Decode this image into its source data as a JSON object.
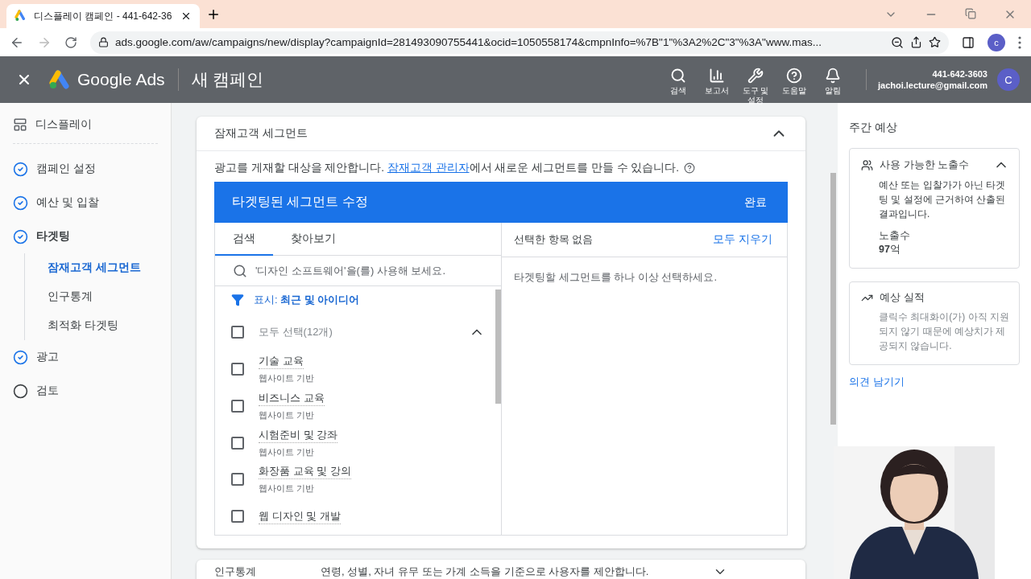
{
  "browser": {
    "tab_title": "디스플레이 캠페인 - 441-642-36",
    "url": "ads.google.com/aw/campaigns/new/display?campaignId=281493090755441&ocid=1050558174&cmpnInfo=%7B\"1\"%3A2%2C\"3\"%3A\"www.mas...",
    "profile": "c"
  },
  "header": {
    "product": "Google Ads",
    "page_title": "새 캠페인",
    "nav": [
      {
        "kind": "search",
        "label": "검색"
      },
      {
        "kind": "reports",
        "label": "보고서"
      },
      {
        "kind": "tools",
        "label": "도구 및 설정"
      },
      {
        "kind": "help",
        "label": "도움말"
      },
      {
        "kind": "bell",
        "label": "알림"
      }
    ],
    "account": {
      "phone": "441-642-3603",
      "email": "jachoi.lecture@gmail.com",
      "avatar": "C"
    }
  },
  "sidebar": {
    "header": "디스플레이",
    "steps": [
      {
        "label": "캠페인 설정",
        "completed": true,
        "selected": false
      },
      {
        "label": "예산 및 입찰",
        "completed": true,
        "selected": false
      },
      {
        "label": "타겟팅",
        "completed": true,
        "selected": true,
        "children": [
          {
            "label": "잠재고객 세그먼트",
            "selected": true
          },
          {
            "label": "인구통계",
            "selected": false
          },
          {
            "label": "최적화 타겟팅",
            "selected": false
          }
        ]
      },
      {
        "label": "광고",
        "completed": true,
        "selected": false
      },
      {
        "label": "검토",
        "completed": false,
        "selected": false
      }
    ]
  },
  "section": {
    "title": "잠재고객 세그먼트",
    "expanded": true,
    "description_before": "광고를 게재할 대상을 제안합니다. ",
    "description_link": "잠재고객 관리자",
    "description_after": "에서 새로운 세그먼트를 만들 수 있습니다.",
    "editor": {
      "title": "타겟팅된 세그먼트 수정",
      "done": "완료",
      "tabs": [
        {
          "label": "검색",
          "selected": true
        },
        {
          "label": "찾아보기",
          "selected": false
        }
      ],
      "search": {
        "placeholder": "'디자인 소프트웨어'을(를) 사용해 보세요."
      },
      "filter": "표시: **최근 및 아이디어**",
      "select_all": {
        "label": "모두 선택(12개)",
        "checked": false,
        "expanded": true
      },
      "items": [
        {
          "name": "기술 교육",
          "source": "웹사이트 기반",
          "checked": false
        },
        {
          "name": "비즈니스 교육",
          "source": "웹사이트 기반",
          "checked": false
        },
        {
          "name": "시험준비 및 강좌",
          "source": "웹사이트 기반",
          "checked": false
        },
        {
          "name": "화장품 교육 및 강의",
          "source": "웹사이트 기반",
          "checked": false
        },
        {
          "name": "웹 디자인 및 개발",
          "checked": false
        }
      ],
      "selected_header": "선택한 항목 없음",
      "clear_all": "모두 지우기",
      "empty_message": "타겟팅할 세그먼트를 하나 이상 선택하세요."
    }
  },
  "next_section": {
    "title": "인구통계",
    "description": "연령, 성별, 자녀 유무 또는 가계 소득을 기준으로 사용자를 제안합니다.",
    "expanded": false
  },
  "forecast": {
    "title": "주간 예상",
    "cards": [
      {
        "kind": "impressions",
        "title": "사용 가능한 노출수",
        "expanded": true,
        "text": "예산 또는 입찰가가 아닌 타겟팅 및 설정에 근거하여 산출된 결과입니다.",
        "metric_label": "노출수",
        "metric_value": "**97**억"
      },
      {
        "kind": "performance",
        "title": "예상 실적",
        "text": "클릭수 최대화이(가) 아직 지원되지 않기 때문에 예상치가 제공되지 않습니다."
      }
    ],
    "feedback_link": "의견 남기기"
  }
}
